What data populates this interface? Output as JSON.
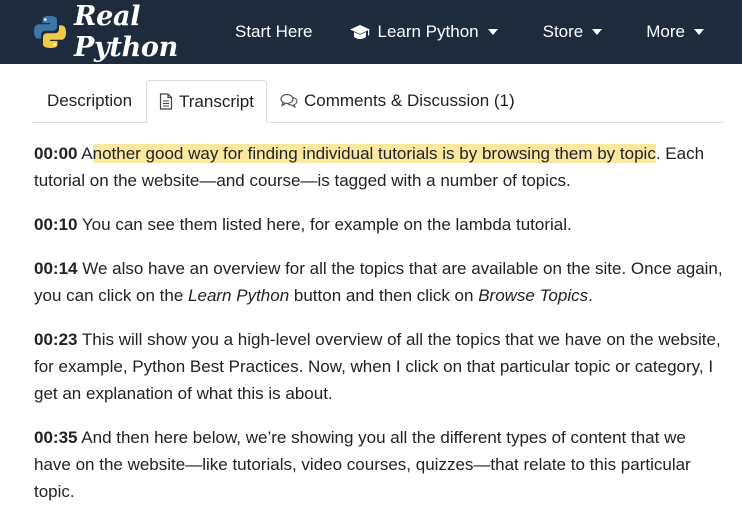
{
  "brand": {
    "name": "Real Python"
  },
  "nav": {
    "start_here": "Start Here",
    "learn_python": "Learn Python",
    "store": "Store",
    "more": "More"
  },
  "tabs": {
    "description": "Description",
    "transcript": "Transcript",
    "comments": "Comments & Discussion (1)",
    "active": "Transcript"
  },
  "transcript": [
    {
      "time": "00:00",
      "first_letter": "A",
      "highlight": "nother good way for finding individual tutorials is by browsing them by topic",
      "rest": ". Each tutorial on the website—and course—is tagged with a number of topics."
    },
    {
      "time": "00:10",
      "text": "You can see them listed here, for example on the lambda tutorial."
    },
    {
      "time": "00:14",
      "text_a": "We also have an overview for all the topics that are available on the site. Once again, you can click on the ",
      "em1": "Learn Python",
      "text_b": " button and then click on ",
      "em2": "Browse Topics",
      "text_c": "."
    },
    {
      "time": "00:23",
      "text": "This will show you a high-level overview of all the topics that we have on the website, for example, Python Best Practices. Now, when I click on that particular topic or category, I get an explanation of what this is about."
    },
    {
      "time": "00:35",
      "text": "And then here below, we’re showing you all the different types of content that we have on the website—like tutorials, video courses, quizzes—that relate to this particular topic."
    }
  ],
  "colors": {
    "navbar": "#1d2b3d",
    "highlight": "#fbe8a0",
    "python_blue": "#3b77a8",
    "python_yellow": "#f6c944"
  }
}
